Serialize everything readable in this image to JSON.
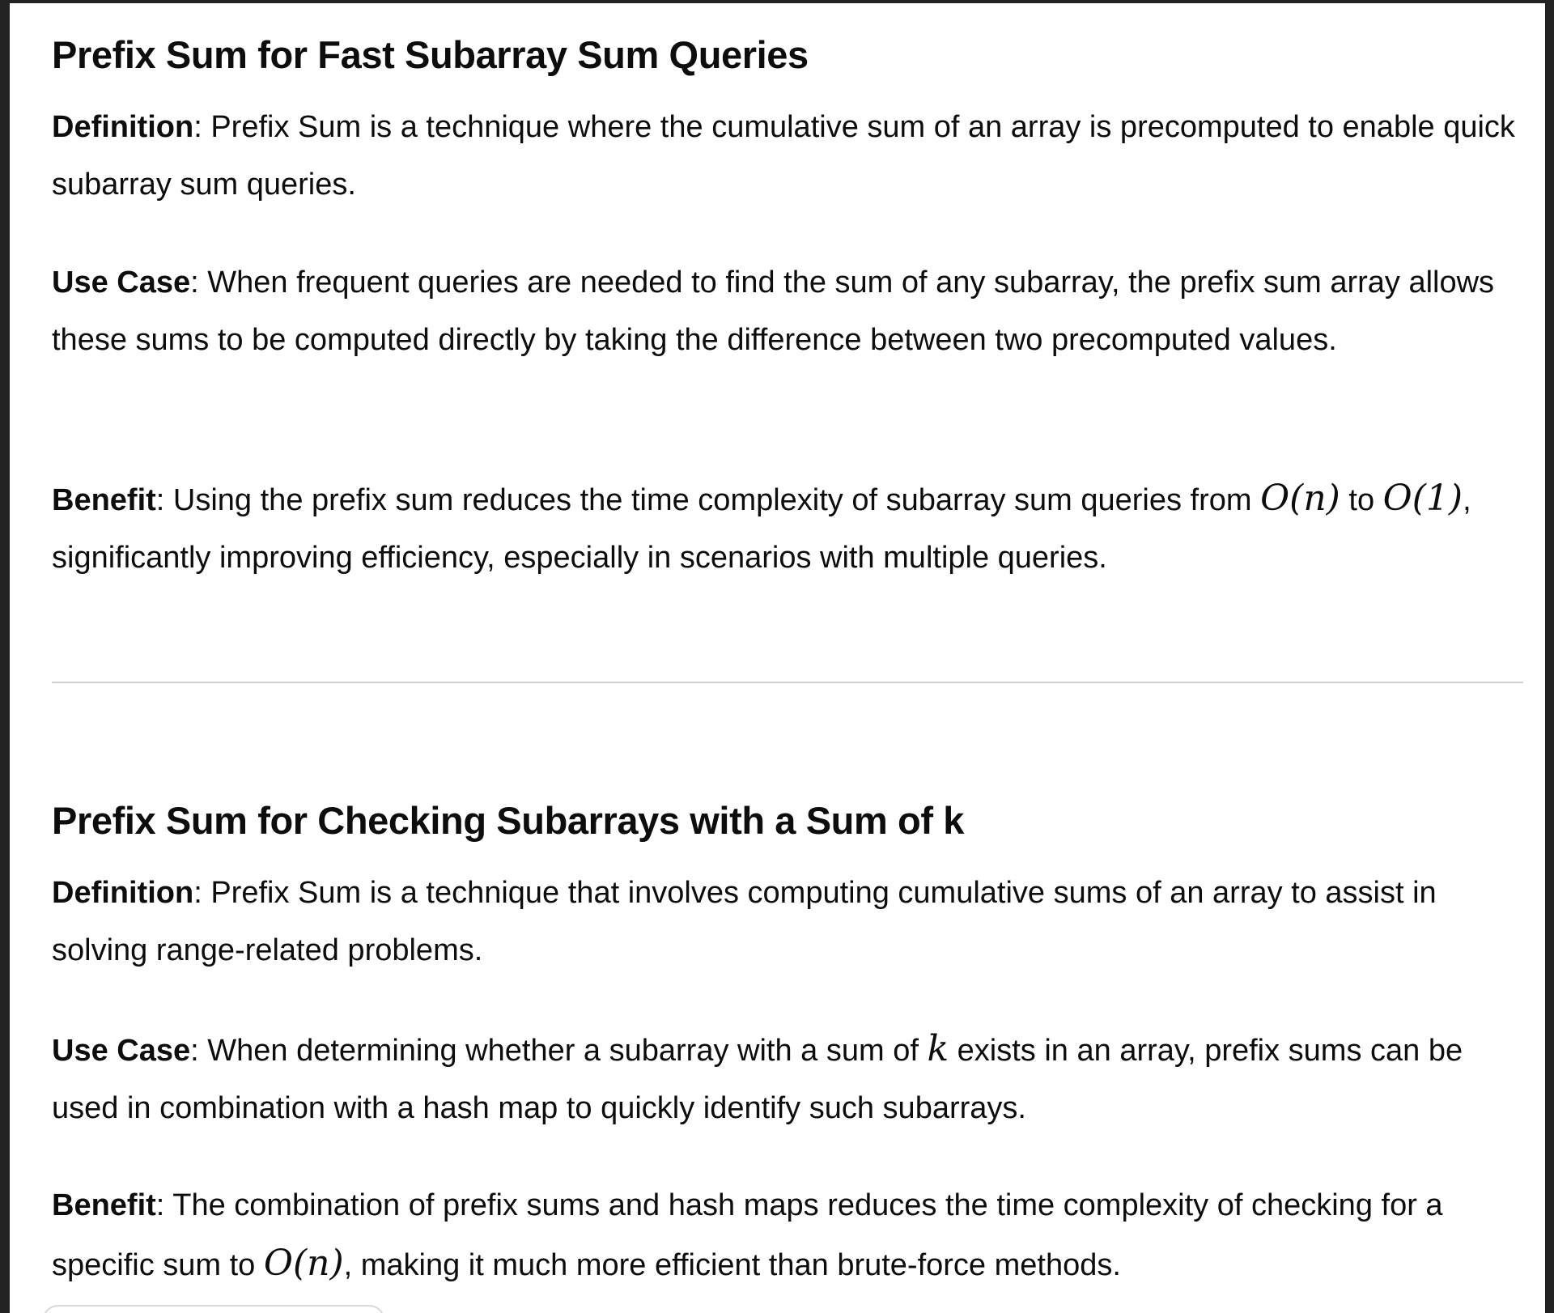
{
  "sections": [
    {
      "title": "Prefix Sum for Fast Subarray Sum Queries",
      "definition": {
        "label": "Definition",
        "text": ": Prefix Sum is a technique where the cumulative sum of an array is precomputed to enable quick subarray sum queries."
      },
      "use_case": {
        "label": "Use Case",
        "text": ": When frequent queries are needed to find the sum of any subarray, the prefix sum array allows these sums to be computed directly by taking the difference between two precomputed values."
      },
      "benefit": {
        "label": "Benefit",
        "text_a": ": Using the prefix sum reduces the time complexity of subarray sum queries from ",
        "math_a": "O(n)",
        "text_b": " to ",
        "math_b": "O(1)",
        "text_c": ", significantly improving efficiency, especially in scenarios with multiple queries."
      }
    },
    {
      "title": "Prefix Sum for Checking Subarrays with a Sum of k",
      "definition": {
        "label": "Definition",
        "text": ": Prefix Sum is a technique that involves computing cumulative sums of an array to assist in solving range-related problems."
      },
      "use_case": {
        "label": "Use Case",
        "text_a": ": When determining whether a subarray with a sum of ",
        "math_a": "k",
        "text_b": " exists in an array, prefix sums can be used in combination with a hash map to quickly identify such subarrays."
      },
      "benefit": {
        "label": "Benefit",
        "text_a": ": The combination of prefix sums and hash maps reduces the time complexity of checking for a specific sum to ",
        "math_a": "O(n)",
        "text_b": ", making it much more efficient than brute-force methods."
      }
    }
  ]
}
